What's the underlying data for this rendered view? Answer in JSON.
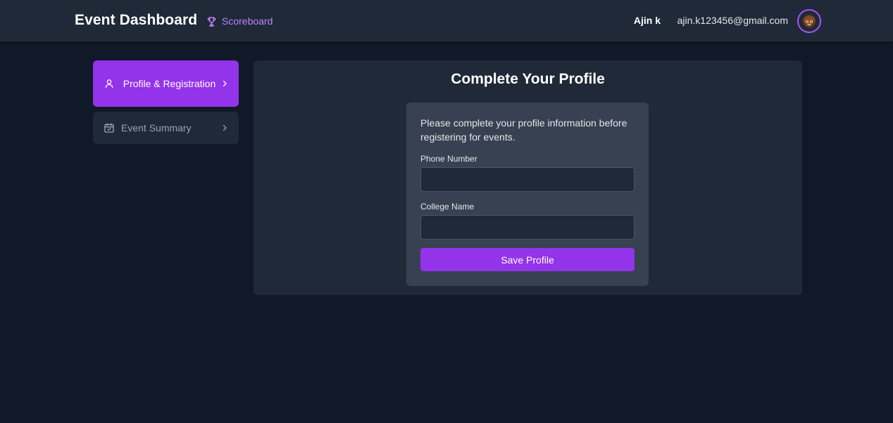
{
  "header": {
    "title": "Event Dashboard",
    "scoreboard_label": "Scoreboard",
    "scoreboard_icon": "trophy-icon",
    "user_name": "Ajin k",
    "user_email": "ajin.k123456@gmail.com",
    "avatar_icon": "avatar-icon"
  },
  "sidebar": {
    "items": [
      {
        "label": "Profile & Registration",
        "icon": "user-icon",
        "active": true
      },
      {
        "label": "Event Summary",
        "icon": "calendar-check-icon",
        "active": false
      }
    ]
  },
  "main": {
    "title": "Complete Your Profile",
    "description": "Please complete your profile information before registering for events.",
    "fields": [
      {
        "label": "Phone Number",
        "value": "",
        "placeholder": ""
      },
      {
        "label": "College Name",
        "value": "",
        "placeholder": ""
      }
    ],
    "save_label": "Save Profile"
  },
  "colors": {
    "page_background": "#111827",
    "header_background": "#1f2937",
    "panel_background": "#1f2937",
    "card_background": "#374151",
    "accent": "#9333ea",
    "accent_light": "#c084fc"
  }
}
